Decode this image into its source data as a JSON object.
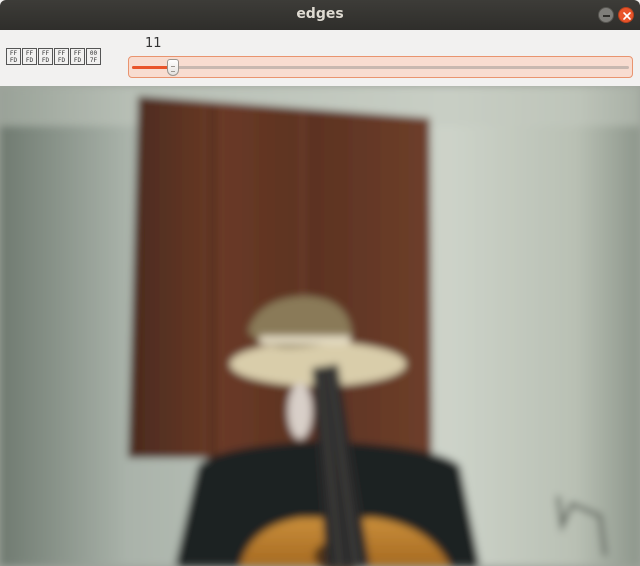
{
  "window": {
    "title": "edges",
    "minimize_symbol": "—",
    "close_symbol": "×"
  },
  "trackbar": {
    "label_glyphs": [
      "FF\nFD",
      "FF\nFD",
      "FF\nFD",
      "FF\nFD",
      "FF\nFD",
      "00\n7F"
    ],
    "value": "11",
    "value_number": 11,
    "max": 255,
    "accent_color": "#e9542a"
  },
  "image": {
    "description_icon": "camera-frame"
  }
}
